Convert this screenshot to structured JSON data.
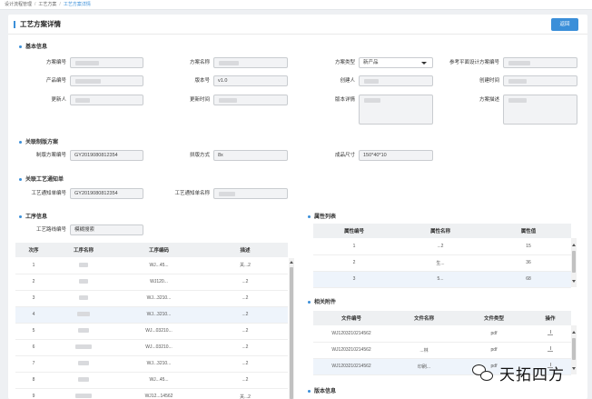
{
  "breadcrumb": [
    "设计流程管理",
    "工艺方案",
    "工艺方案详情"
  ],
  "page": {
    "title": "工艺方案详情",
    "back_label": "返回"
  },
  "basic": {
    "section": "基本信息",
    "fields": {
      "plan_no": "方案编号",
      "plan_name": "方案名称",
      "plan_type": "方案类型",
      "plan_type_value": "新产品",
      "ref_plan": "参考平面设计方案编号",
      "product_no": "产品编号",
      "version": "版本号",
      "version_value": "v1.0",
      "creator": "创建人",
      "create_time": "创建时间",
      "updater": "更新人",
      "update_time": "更新时间",
      "version_detail": "版本详情",
      "plan_desc": "方案描述"
    }
  },
  "board": {
    "section": "关联制版方案",
    "plan_no_label": "制版方案编号",
    "plan_no_value": "GY2019080812354",
    "layout_label": "拼版方式",
    "layout_value": "8x",
    "size_label": "成品尺寸",
    "size_value": "150*40*10"
  },
  "notice": {
    "section": "关联工艺通知单",
    "no_label": "工艺通知单编号",
    "no_value": "GY2019080812354",
    "name_label": "工艺通知单名称"
  },
  "process": {
    "section": "工序信息",
    "route_label": "工艺路线编号",
    "route_placeholder": "模糊搜索",
    "headers": [
      "次序",
      "工序名称",
      "工序编码",
      "描述"
    ],
    "rows": [
      {
        "seq": "1",
        "code": "WJ...45...",
        "desc": "关...2"
      },
      {
        "seq": "2",
        "code": "WJ120...",
        "desc": "...2"
      },
      {
        "seq": "3",
        "code": "WJ...3210...",
        "desc": "...2"
      },
      {
        "seq": "4",
        "code": "WJ...3210...",
        "desc": "...2"
      },
      {
        "seq": "5",
        "code": "WJ...03210...",
        "desc": "...2"
      },
      {
        "seq": "6",
        "code": "WJ...03210...",
        "desc": "...2"
      },
      {
        "seq": "7",
        "code": "WJ...3210...",
        "desc": "...2"
      },
      {
        "seq": "8",
        "code": "WJ...45...",
        "desc": "...2"
      },
      {
        "seq": "9",
        "code": "WJ12...14562",
        "desc": "关...2"
      }
    ]
  },
  "attributes": {
    "section": "属性列表",
    "headers": [
      "属性编号",
      "属性名称",
      "属性值"
    ],
    "rows": [
      {
        "no": "1",
        "name": "...2",
        "value": "15"
      },
      {
        "no": "2",
        "name": "生...",
        "value": "36"
      },
      {
        "no": "3",
        "name": "5...",
        "value": "68"
      }
    ]
  },
  "attachments": {
    "section": "相关附件",
    "headers": [
      "文件编号",
      "文件名称",
      "文件类型",
      "操作"
    ],
    "rows": [
      {
        "no": "WJ1203210214562",
        "name": "",
        "type": "pdf"
      },
      {
        "no": "WJ1203210214562",
        "name": "...林",
        "type": "pdf"
      },
      {
        "no": "WJ1203210214562",
        "name": "印刷...",
        "type": "pdf"
      }
    ]
  },
  "version_section": "版本信息",
  "watermark": "天拓四方",
  "colors": {
    "accent": "#3b8fd9",
    "header_bg": "#eef0f2",
    "highlight_row": "#eef4fb"
  }
}
